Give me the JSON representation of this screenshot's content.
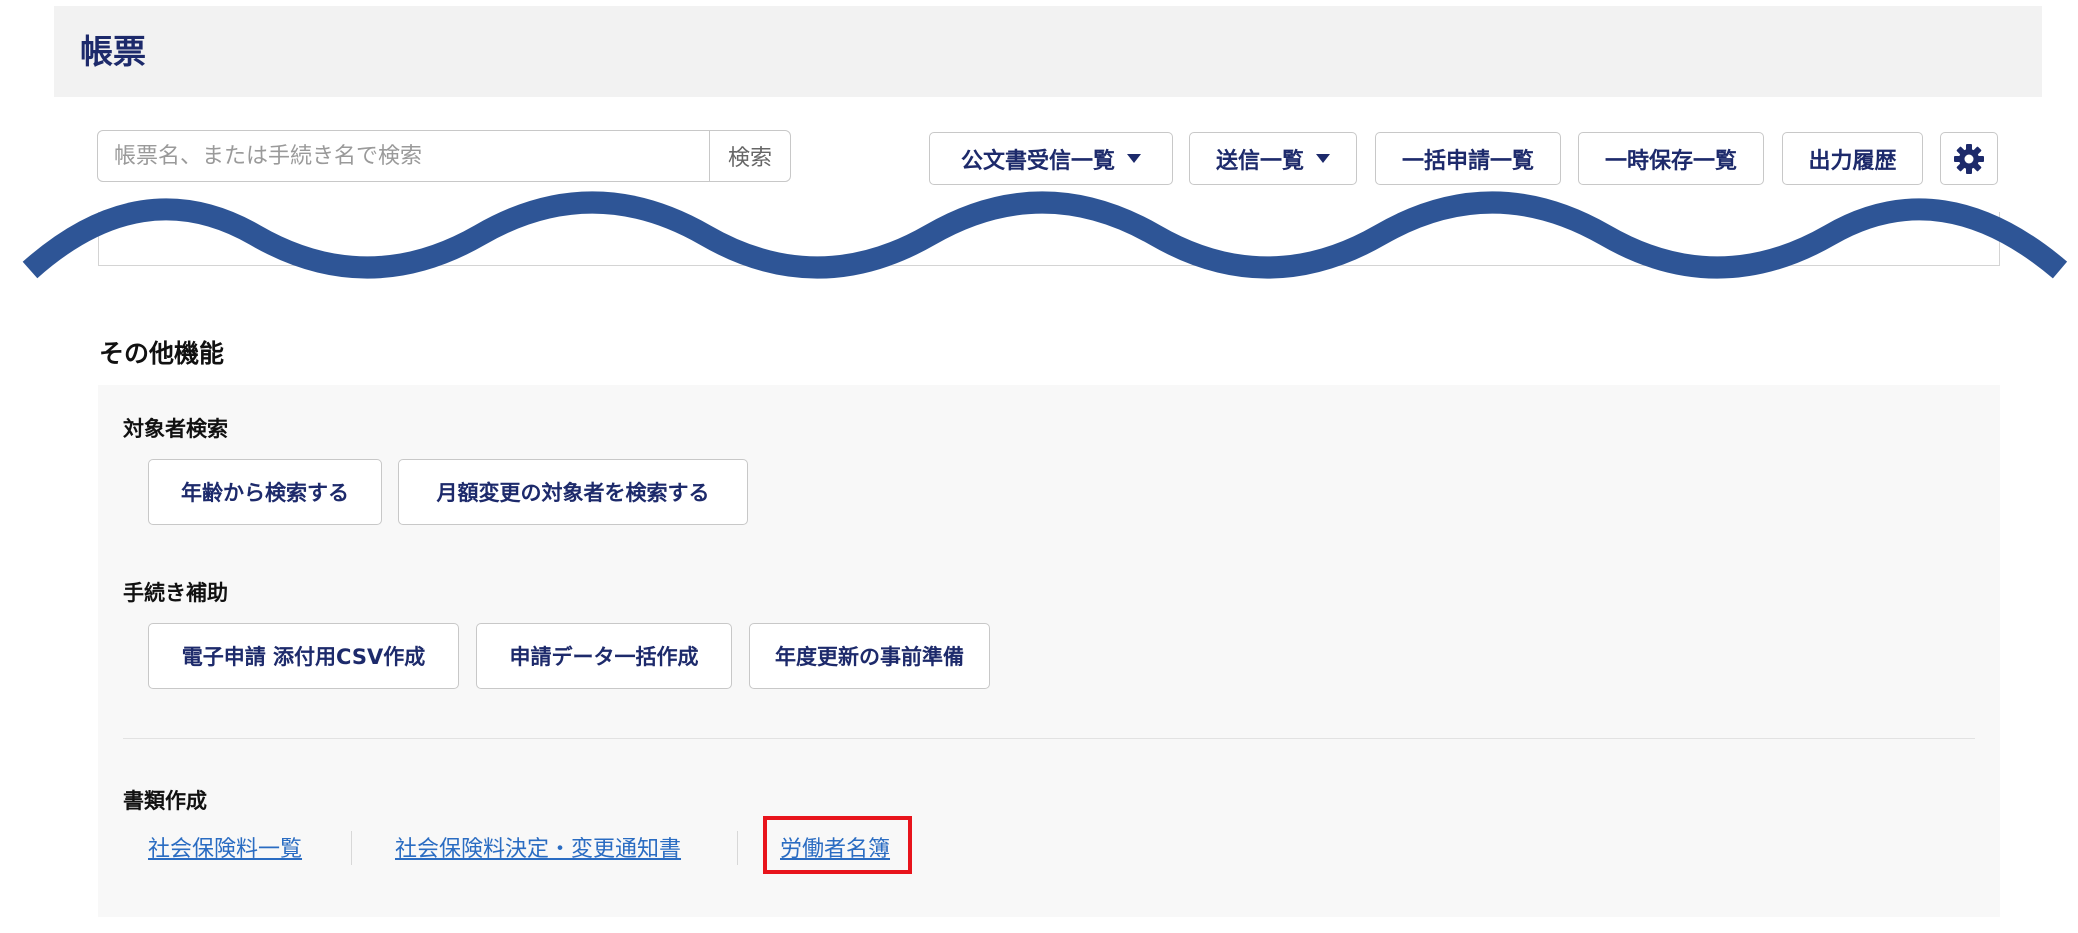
{
  "header": {
    "title": "帳票"
  },
  "search": {
    "placeholder": "帳票名、または手続き名で検索",
    "button_label": "検索"
  },
  "toolbar": {
    "official_docs_label": "公文書受信一覧",
    "sent_list_label": "送信一覧",
    "bulk_applications_label": "一括申請一覧",
    "temp_saved_label": "一時保存一覧",
    "output_history_label": "出力履歴",
    "settings_icon": "gear-icon"
  },
  "decoration": {
    "wave_color": "#2e5596"
  },
  "other_functions": {
    "title": "その他機能",
    "target_search": {
      "label": "対象者検索",
      "buttons": [
        "年齢から検索する",
        "月額変更の対象者を検索する"
      ]
    },
    "procedure_support": {
      "label": "手続き補助",
      "buttons": [
        "電子申請 添付用CSV作成",
        "申請データ一括作成",
        "年度更新の事前準備"
      ]
    },
    "document_creation": {
      "label": "書類作成",
      "links": [
        "社会保険料一覧",
        "社会保険料決定・変更通知書",
        "労働者名簿"
      ],
      "highlighted_link_color": "#e8141c"
    }
  },
  "colors": {
    "navy_text": "#1d2a6b",
    "link": "#2a6cc2",
    "header_bg": "#f2f2f2",
    "panel_bg": "#f8f8f8"
  }
}
